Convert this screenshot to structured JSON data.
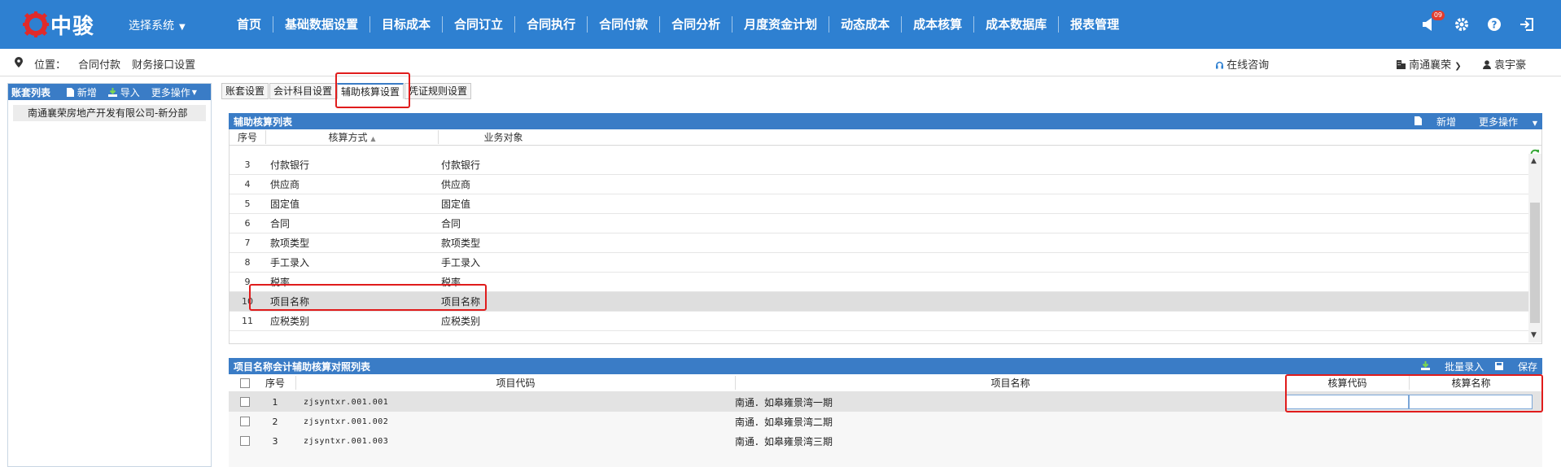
{
  "brand": {
    "logo_text": "中骏"
  },
  "topbar": {
    "system_select": "选择系统",
    "nav": [
      "首页",
      "基础数据设置",
      "目标成本",
      "合同订立",
      "合同执行",
      "合同付款",
      "合同分析",
      "月度资金计划",
      "动态成本",
      "成本核算",
      "成本数据库",
      "报表管理"
    ],
    "notify_badge": "09",
    "icons": [
      "notification-icon",
      "gear-icon",
      "help-icon",
      "logout-icon"
    ]
  },
  "location": {
    "label": "位置：",
    "crumbs": [
      "合同付款",
      "财务接口设置"
    ],
    "consult": "在线咨询",
    "company": "南通襄荣",
    "user": "袁宇豪"
  },
  "left_panel": {
    "title": "账套列表",
    "add": "新增",
    "import": "导入",
    "more": "更多操作",
    "items": [
      "南通襄荣房地产开发有限公司-新分部"
    ]
  },
  "tabs": [
    "账套设置",
    "会计科目设置",
    "辅助核算设置",
    "凭证规则设置"
  ],
  "aux_list": {
    "title": "辅助核算列表",
    "add": "新增",
    "more": "更多操作",
    "columns": [
      "序号",
      "核算方式",
      "业务对象"
    ],
    "rows": [
      {
        "no": "3",
        "method": "付款银行",
        "object": "付款银行"
      },
      {
        "no": "4",
        "method": "供应商",
        "object": "供应商"
      },
      {
        "no": "5",
        "method": "固定值",
        "object": "固定值"
      },
      {
        "no": "6",
        "method": "合同",
        "object": "合同"
      },
      {
        "no": "7",
        "method": "款项类型",
        "object": "款项类型"
      },
      {
        "no": "8",
        "method": "手工录入",
        "object": "手工录入"
      },
      {
        "no": "9",
        "method": "税率",
        "object": "税率"
      },
      {
        "no": "10",
        "method": "项目名称",
        "object": "项目名称"
      },
      {
        "no": "11",
        "method": "应税类别",
        "object": "应税类别"
      }
    ],
    "selected_row": 7
  },
  "mapping_list": {
    "title": "项目名称会计辅助核算对照列表",
    "batch": "批量录入",
    "save": "保存",
    "columns": [
      "序号",
      "项目代码",
      "项目名称",
      "核算代码",
      "核算名称"
    ],
    "rows": [
      {
        "no": "1",
        "code": "zjsyntxr.001.001",
        "name": "南通．如皋雍景湾一期"
      },
      {
        "no": "2",
        "code": "zjsyntxr.001.002",
        "name": "南通．如皋雍景湾二期"
      },
      {
        "no": "3",
        "code": "zjsyntxr.001.003",
        "name": "南通．如皋雍景湾三期"
      }
    ]
  },
  "colors": {
    "brand_blue": "#2e80d1",
    "panel_blue": "#3a7cc6",
    "highlight_red": "#e01c1c"
  }
}
